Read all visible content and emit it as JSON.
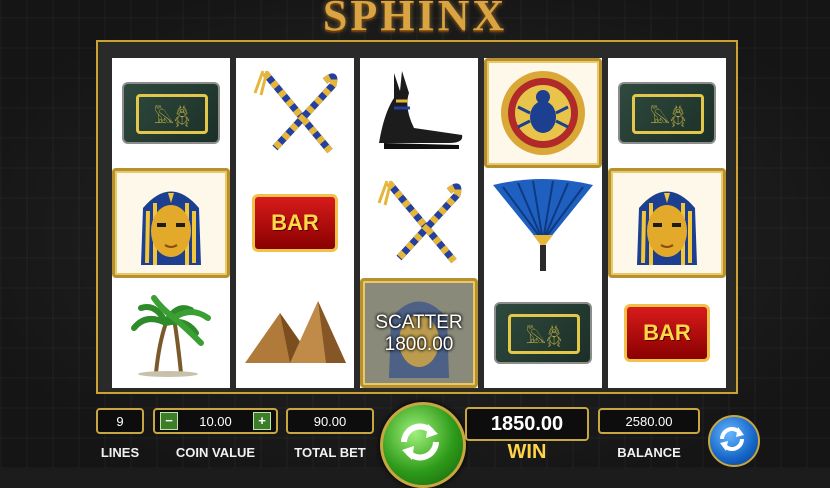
{
  "game": {
    "title": "SPHINX"
  },
  "reels": [
    {
      "symbols": [
        "hieroglyph-tablet",
        "pharaoh-mask",
        "palm-trees"
      ]
    },
    {
      "symbols": [
        "crook-and-flail",
        "bar",
        "pyramids"
      ]
    },
    {
      "symbols": [
        "anubis",
        "crook-and-flail",
        "scatter-pharaoh"
      ]
    },
    {
      "symbols": [
        "scarab-medallion",
        "blue-fan",
        "hieroglyph-tablet"
      ]
    },
    {
      "symbols": [
        "hieroglyph-tablet",
        "pharaoh-mask",
        "bar"
      ]
    }
  ],
  "symbol_text": {
    "bar": "BAR",
    "scatter_label": "SCATTER",
    "scatter_amount": "1800.00"
  },
  "controls": {
    "lines_value": "9",
    "lines_label": "LINES",
    "coin_value": "10.00",
    "coin_value_label": "COIN VALUE",
    "coin_minus": "−",
    "coin_plus": "+",
    "total_bet_value": "90.00",
    "total_bet_label": "TOTAL BET",
    "win_value": "1850.00",
    "win_label": "WIN",
    "balance_value": "2580.00",
    "balance_label": "BALANCE"
  },
  "colors": {
    "gold": "#c8a640",
    "spin_green": "#2e9b1a",
    "auto_blue": "#1565c8",
    "win_yellow": "#ffd44a"
  }
}
